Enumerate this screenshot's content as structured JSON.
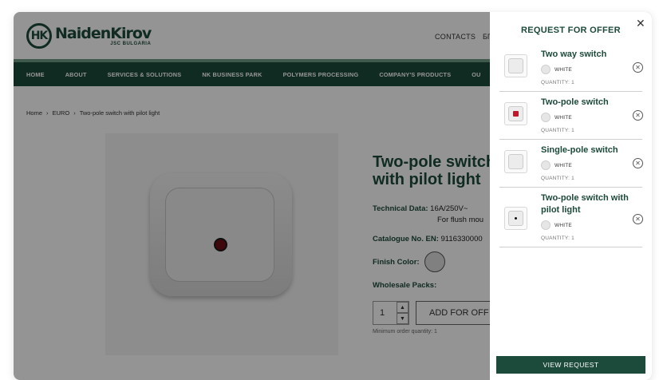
{
  "header": {
    "logo_mark": "HK",
    "logo_name": "NaidenKirov",
    "logo_suffix": "JSC",
    "logo_sub": "BULGARIA",
    "contacts": "CONTACTS",
    "lang": "БГ"
  },
  "nav": [
    "HOME",
    "ABOUT",
    "SERVICES & SOLUTIONS",
    "NK BUSINESS PARK",
    "POLYMERS PROCESSING",
    "COMPANY'S PRODUCTS",
    "OU"
  ],
  "breadcrumb": [
    "Home",
    "EURO",
    "Two-pole switch with pilot light"
  ],
  "product": {
    "title": "Two-pole switch with pilot light",
    "tech_label": "Technical Data:",
    "tech_value1": "16A/250V~",
    "tech_value2": "For flush mou",
    "catalogue_label": "Catalogue No. EN:",
    "catalogue_value": "9116330000",
    "finish_label": "Finish Color:",
    "wholesale_label": "Wholesale Packs:",
    "qty": "1",
    "add_button": "ADD FOR OFF",
    "min_order": "Minimum order quantity: 1"
  },
  "panel": {
    "title": "REQUEST FOR OFFER",
    "items": [
      {
        "name": "Two way switch",
        "color": "WHITE",
        "quantity": "QUANTITY: 1"
      },
      {
        "name": "Two-pole switch",
        "color": "WHITE",
        "quantity": "QUANTITY: 1"
      },
      {
        "name": "Single-pole switch",
        "color": "WHITE",
        "quantity": "QUANTITY: 1"
      },
      {
        "name": "Two-pole switch with pilot light",
        "color": "WHITE",
        "quantity": "QUANTITY: 1"
      }
    ],
    "view_button": "VIEW REQUEST"
  },
  "colors": {
    "brand_green": "#1c4a3b",
    "stripe": "#6f9a86"
  }
}
